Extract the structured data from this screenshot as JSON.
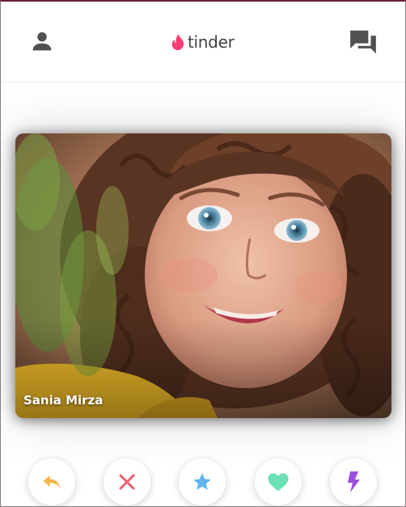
{
  "app": {
    "logo_text": "tinder",
    "brand_color": "#fe3c72"
  },
  "header": {
    "left_icon": "person-icon",
    "right_icon": "chat-bubbles-icon",
    "icon_color": "#505050"
  },
  "card": {
    "name": "Sania Mirza"
  },
  "actions": [
    {
      "id": "rewind",
      "icon": "rewind-arrow-icon",
      "color": "#f5b748"
    },
    {
      "id": "nope",
      "icon": "x-icon",
      "color": "#ec5e6f"
    },
    {
      "id": "super-like",
      "icon": "star-icon",
      "color": "#62b4f0"
    },
    {
      "id": "like",
      "icon": "heart-icon",
      "color": "#6be1b4"
    },
    {
      "id": "boost",
      "icon": "lightning-icon",
      "color": "#9b4ddc"
    }
  ]
}
